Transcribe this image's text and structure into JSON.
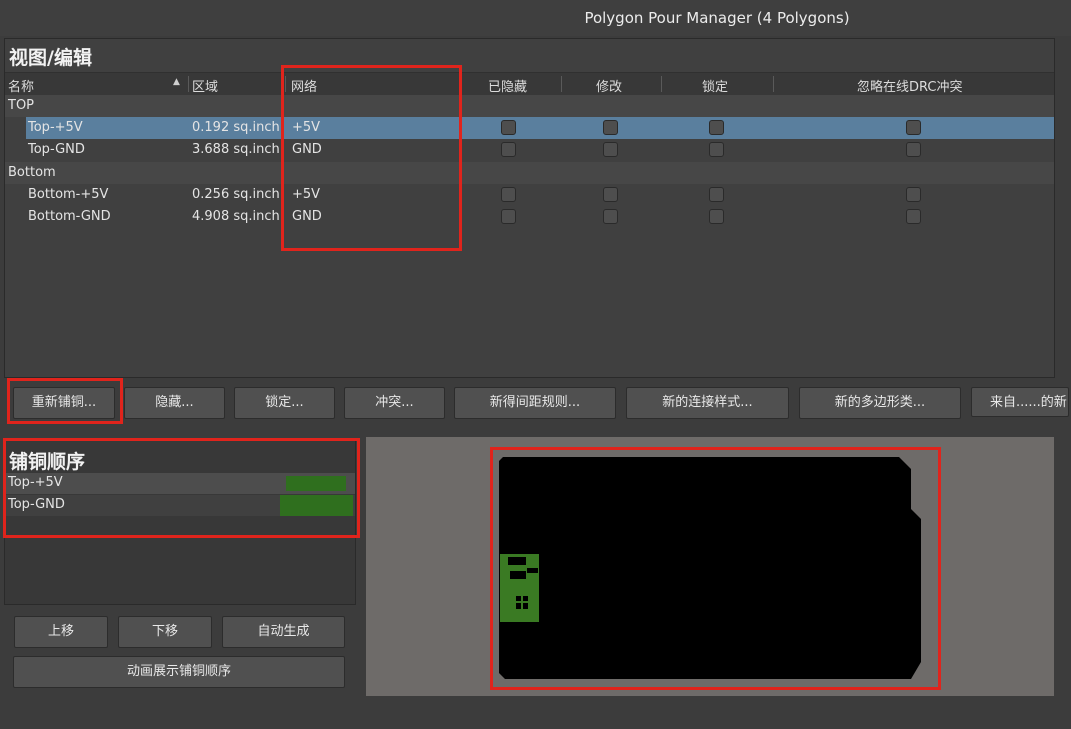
{
  "window": {
    "title": "Polygon Pour Manager (4 Polygons)"
  },
  "view_panel": {
    "title": "视图/编辑",
    "columns": [
      "名称",
      "区域",
      "网络",
      "已隐藏",
      "修改",
      "锁定",
      "忽略在线DRC冲突"
    ],
    "groups": [
      {
        "label": "TOP",
        "rows": [
          {
            "name": "Top-+5V",
            "area": "0.192 sq.inch",
            "net": "+5V",
            "selected": true
          },
          {
            "name": "Top-GND",
            "area": "3.688 sq.inch",
            "net": "GND",
            "selected": false
          }
        ]
      },
      {
        "label": "Bottom",
        "rows": [
          {
            "name": "Bottom-+5V",
            "area": "0.256 sq.inch",
            "net": "+5V",
            "selected": false
          },
          {
            "name": "Bottom-GND",
            "area": "4.908 sq.inch",
            "net": "GND",
            "selected": false
          }
        ]
      }
    ]
  },
  "action_buttons": [
    "重新铺铜...",
    "隐藏...",
    "锁定...",
    "冲突...",
    "新得间距规则...",
    "新的连接样式...",
    "新的多边形类...",
    "来自......的新"
  ],
  "pour_order": {
    "title": "铺铜顺序",
    "items": [
      "Top-+5V",
      "Top-GND"
    ]
  },
  "order_buttons": {
    "up": "上移",
    "down": "下移",
    "auto": "自动生成",
    "animate": "动画展示铺铜顺序"
  },
  "colors": {
    "selection": "#5a7f9e",
    "highlight_box": "#e0241c",
    "copper_green": "#2f6f1e"
  }
}
